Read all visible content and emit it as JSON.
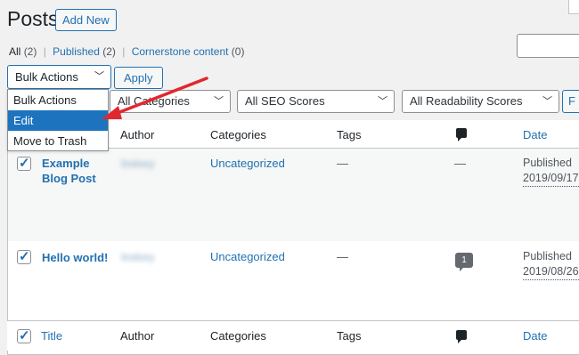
{
  "header": {
    "title": "Posts",
    "add_new_label": "Add New"
  },
  "filters_links": {
    "all_label": "All",
    "all_count": "(2)",
    "published_label": "Published",
    "published_count": "(2)",
    "cornerstone_label": "Cornerstone content",
    "cornerstone_count": "(0)",
    "separator": "|"
  },
  "bulk_actions": {
    "selected": "Bulk Actions",
    "apply_label": "Apply",
    "options": [
      "Bulk Actions",
      "Edit",
      "Move to Trash"
    ],
    "highlighted_option": "Edit"
  },
  "filter_selects": {
    "categories": "All Categories",
    "seo": "All SEO Scores",
    "readability": "All Readability Scores",
    "filter_button_fragment": "F"
  },
  "table": {
    "columns": {
      "title": "Title",
      "author": "Author",
      "categories": "Categories",
      "tags": "Tags",
      "date": "Date"
    },
    "rows": [
      {
        "title_line1": "Example",
        "title_line2": "Blog Post",
        "author": "lindsey",
        "category": "Uncategorized",
        "tags": "—",
        "comments": "—",
        "status": "Published",
        "date": "2019/09/17"
      },
      {
        "title_line1": "Hello world!",
        "author": "lindsey",
        "category": "Uncategorized",
        "tags": "—",
        "comments": "1",
        "status": "Published",
        "date": "2019/08/26"
      }
    ]
  },
  "colors": {
    "link": "#2271b1",
    "highlight": "#1e73be",
    "arrow": "#e0282e"
  },
  "icons": {
    "chevron": "chevron-down-icon",
    "comment": "comment-icon",
    "check": "checkmark-icon"
  }
}
